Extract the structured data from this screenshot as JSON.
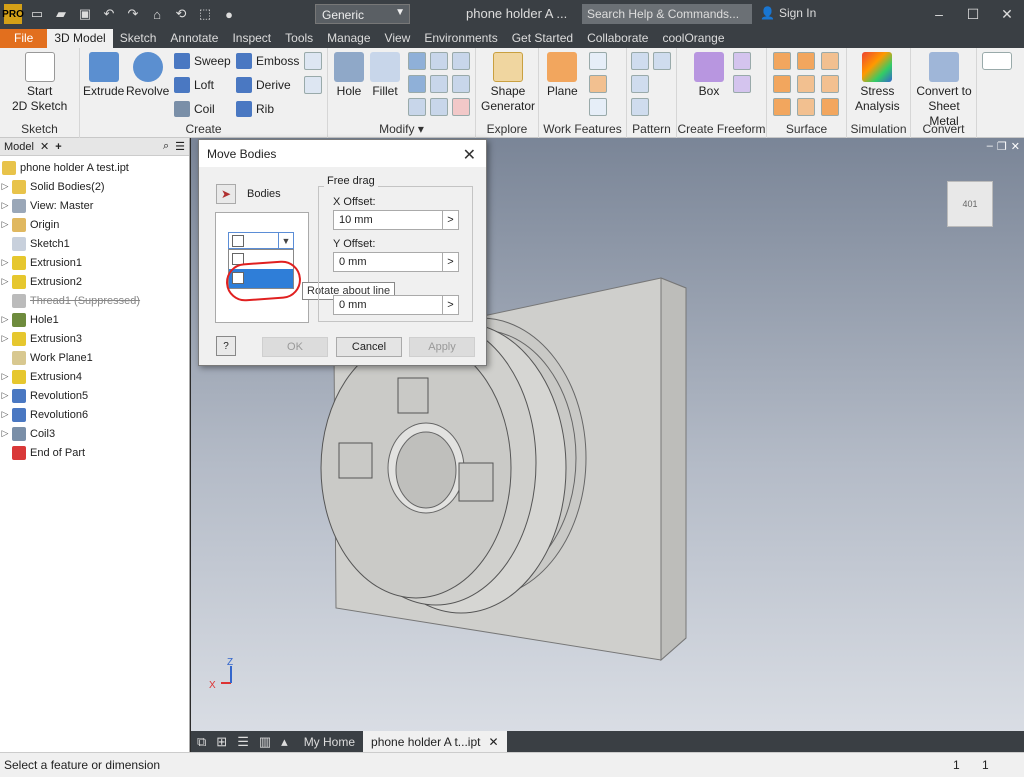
{
  "titlebar": {
    "app_icon": "PRO",
    "material": "Generic",
    "doc_title": "phone holder A ...",
    "search_placeholder": "Search Help & Commands...",
    "sign_in": "Sign In"
  },
  "tabs": [
    "File",
    "3D Model",
    "Sketch",
    "Annotate",
    "Inspect",
    "Tools",
    "Manage",
    "View",
    "Environments",
    "Get Started",
    "Collaborate",
    "coolOrange"
  ],
  "ribbon": {
    "sketch": {
      "title": "Sketch",
      "start": "Start",
      "start2": "2D Sketch"
    },
    "create": {
      "title": "Create",
      "extrude": "Extrude",
      "revolve": "Revolve",
      "sweep": "Sweep",
      "loft": "Loft",
      "coil": "Coil",
      "emboss": "Emboss",
      "derive": "Derive",
      "rib": "Rib"
    },
    "modify": {
      "title": "Modify",
      "hole": "Hole",
      "fillet": "Fillet"
    },
    "explore": {
      "title": "Explore",
      "shape": "Shape",
      "generator": "Generator"
    },
    "work": {
      "title": "Work Features",
      "plane": "Plane"
    },
    "pattern": {
      "title": "Pattern"
    },
    "freeform": {
      "title": "Create Freeform",
      "box": "Box"
    },
    "surface": {
      "title": "Surface"
    },
    "simulation": {
      "title": "Simulation",
      "stress": "Stress",
      "analysis": "Analysis"
    },
    "convert": {
      "title": "Convert",
      "convert_to": "Convert to",
      "sheet_metal": "Sheet Metal"
    }
  },
  "browser": {
    "tab": "Model",
    "root": "phone holder A test.ipt",
    "nodes": [
      {
        "label": "Solid Bodies(2)",
        "color": "#e8c34a",
        "caret": true
      },
      {
        "label": "View: Master",
        "color": "#9aa7b8",
        "caret": true
      },
      {
        "label": "Origin",
        "color": "#e0b860",
        "caret": true
      },
      {
        "label": "Sketch1",
        "color": "#c8d0dc",
        "caret": false
      },
      {
        "label": "Extrusion1",
        "color": "#e6c72e",
        "caret": true
      },
      {
        "label": "Extrusion2",
        "color": "#e6c72e",
        "caret": true
      },
      {
        "label": "Thread1 (Suppressed)",
        "color": "#bbbbbb",
        "caret": false,
        "suppressed": true
      },
      {
        "label": "Hole1",
        "color": "#6e8b3d",
        "caret": true
      },
      {
        "label": "Extrusion3",
        "color": "#e6c72e",
        "caret": true
      },
      {
        "label": "Work Plane1",
        "color": "#d8c890",
        "caret": false
      },
      {
        "label": "Extrusion4",
        "color": "#e6c72e",
        "caret": true
      },
      {
        "label": "Revolution5",
        "color": "#4a78c2",
        "caret": true
      },
      {
        "label": "Revolution6",
        "color": "#4a78c2",
        "caret": true
      },
      {
        "label": "Coil3",
        "color": "#7a8fa8",
        "caret": true
      },
      {
        "label": "End of Part",
        "color": "#d93838",
        "caret": false
      }
    ]
  },
  "dialog": {
    "title": "Move Bodies",
    "bodies_label": "Bodies",
    "mode_label": "Free drag",
    "x_label": "X Offset:",
    "x_value": "10 mm",
    "y_label": "Y Offset:",
    "y_value": "0 mm",
    "z_value": "0 mm",
    "tooltip": "Rotate about line",
    "ok": "OK",
    "cancel": "Cancel",
    "apply": "Apply"
  },
  "viewcube": {
    "face": "401"
  },
  "doc_tabs": {
    "home": "My Home",
    "doc": "phone holder A t...ipt"
  },
  "status": {
    "text": "Select a feature or dimension",
    "n1": "1",
    "n2": "1"
  },
  "colors": {
    "accent": "#e26f1e",
    "selection": "#2f7ed8",
    "annotation": "#e02020"
  }
}
